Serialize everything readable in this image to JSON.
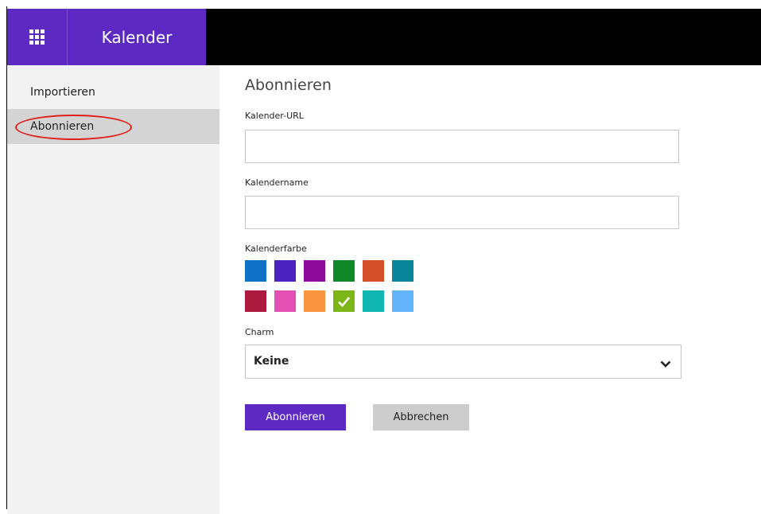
{
  "app": {
    "title": "Kalender"
  },
  "sidebar": {
    "items": [
      {
        "label": "Importieren",
        "active": false
      },
      {
        "label": "Abonnieren",
        "active": true
      }
    ]
  },
  "form": {
    "heading": "Abonnieren",
    "url_label": "Kalender-URL",
    "url_value": "",
    "name_label": "Kalendername",
    "name_value": "",
    "color_label": "Kalenderfarbe",
    "colors": [
      [
        "#0f72c6",
        "#4c22c0",
        "#8f0b9b",
        "#118826",
        "#d34f28",
        "#09859a"
      ],
      [
        "#ad1a40",
        "#e150b2",
        "#fb9540",
        "#7bb518",
        "#0fb5b0",
        "#63b3fa"
      ]
    ],
    "selected_color": "#7bb518",
    "charm_label": "Charm",
    "charm_value": "Keine"
  },
  "buttons": {
    "subscribe": "Abonnieren",
    "cancel": "Abbrechen"
  },
  "icons": {
    "launcher": "waffle-icon",
    "dropdown": "chevron-down-icon",
    "selected": "checkmark-icon"
  }
}
